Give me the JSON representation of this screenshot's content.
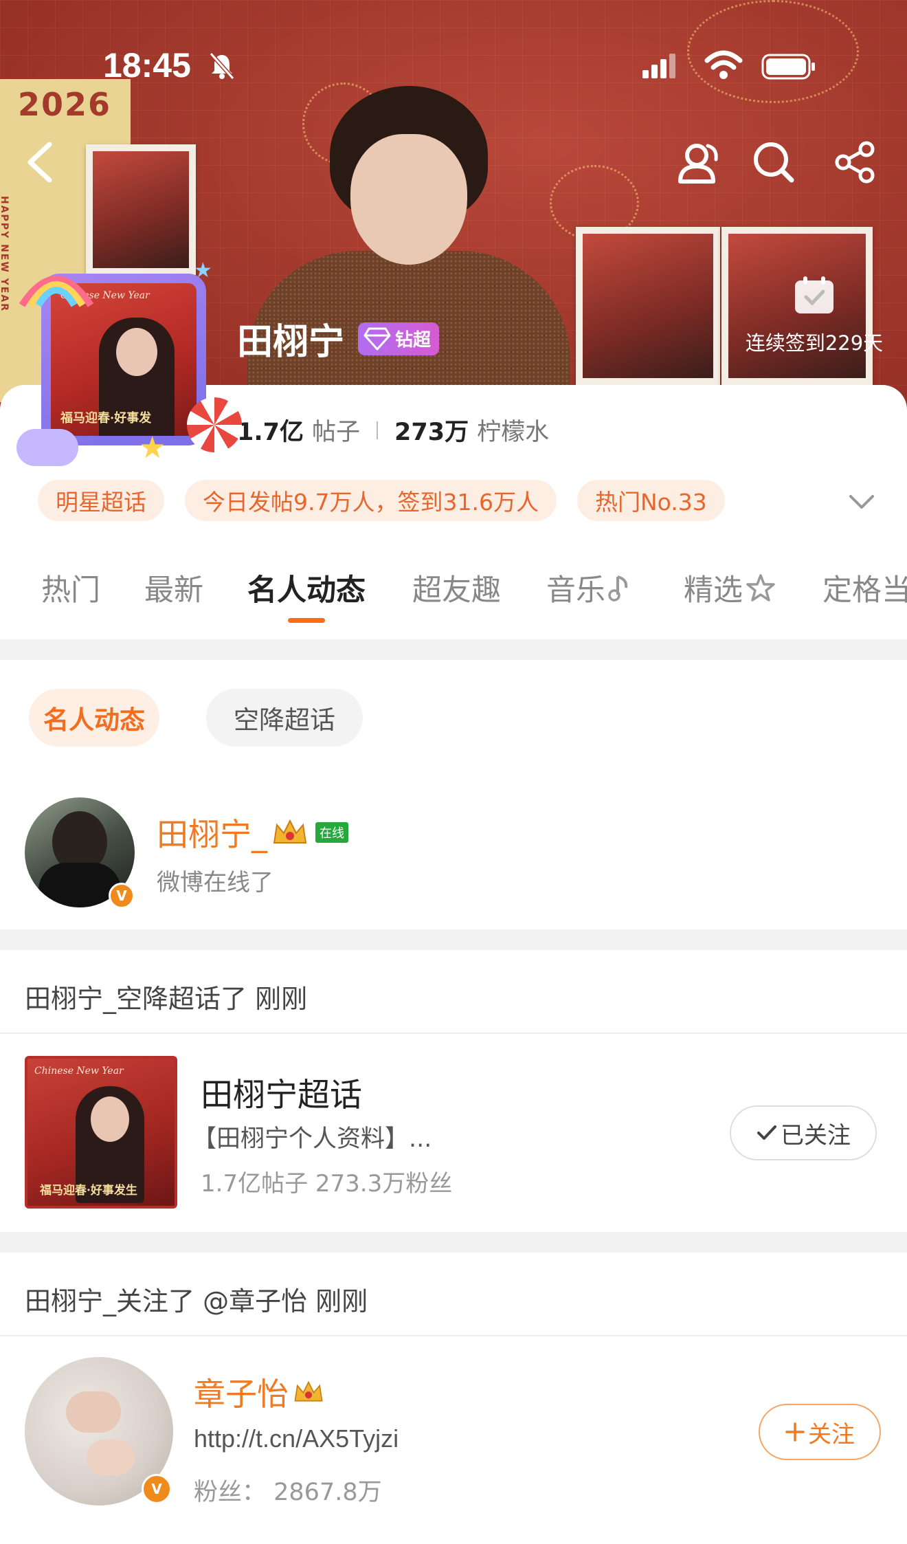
{
  "status_bar": {
    "time": "18:45"
  },
  "header": {
    "banner": {
      "year": "2026",
      "side_text": "HAPPY NEW YEAR"
    },
    "avatar": {
      "caption_top": "Chinese New Year",
      "caption_bottom": "福马迎春·好事发"
    },
    "name": "田栩宁",
    "badge": "钻超",
    "checkin": "连续签到229天"
  },
  "stats": {
    "posts_value": "1.7亿",
    "posts_label": "帖子",
    "lemon_value": "273万",
    "lemon_label": "柠檬水"
  },
  "tags": [
    "明星超话",
    "今日发帖9.7万人，签到31.6万人",
    "热门No.33"
  ],
  "tabs": [
    "热门",
    "最新",
    "名人动态",
    "超友趣",
    "音乐",
    "精选",
    "定格当"
  ],
  "active_tab": "名人动态",
  "sub_tabs": {
    "active": "名人动态",
    "other": "空降超话"
  },
  "online_user": {
    "name": "田栩宁_",
    "status_badge": "在线",
    "desc": "微博在线了"
  },
  "activity1": {
    "header": "田栩宁_空降超话了 刚刚",
    "topic": {
      "image_caption_top": "Chinese New Year",
      "image_caption_bottom": "福马迎春·好事发生",
      "title": "田栩宁超话",
      "desc": "【田栩宁个人资料】...",
      "meta": "1.7亿帖子  273.3万粉丝",
      "button": "已关注"
    }
  },
  "activity2": {
    "header": "田栩宁_关注了 @章子怡 刚刚",
    "user": {
      "name": "章子怡",
      "link": "http://t.cn/AX5Tyjzi",
      "fans": "粉丝：  2867.8万",
      "button": "关注"
    }
  },
  "colors": {
    "accent": "#f07a22",
    "banner": "#a43a2e",
    "tag_bg": "#fdeee4",
    "vip_badge": "#b06ef1"
  }
}
